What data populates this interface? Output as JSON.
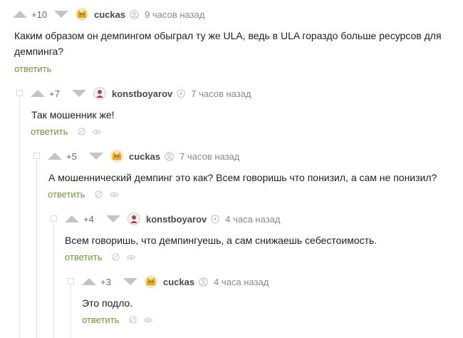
{
  "comments": [
    {
      "rating": "+10",
      "username": "cuckas",
      "time": "9 часов назад",
      "text": "Каким образом он демпингом обыграл ту же ULA, ведь в ULA гораздо больше ресурсов для демпинга?",
      "reply_label": "ответить"
    },
    {
      "rating": "+7",
      "username": "konstboyarov",
      "time": "7 часов назад",
      "text": "Так мошенник же!",
      "reply_label": "ответить"
    },
    {
      "rating": "+5",
      "username": "cuckas",
      "time": "7 часов назад",
      "text": "А мошеннический демпинг это как? Всем говоришь что понизил, а сам не понизил?",
      "reply_label": "ответить"
    },
    {
      "rating": "+4",
      "username": "konstboyarov",
      "time": "4 часа назад",
      "text": "Всем говоришь, что демпингуешь, а сам снижаешь себестоимость.",
      "reply_label": "ответить"
    },
    {
      "rating": "+3",
      "username": "cuckas",
      "time": "4 часа назад",
      "text": "Это подло.",
      "reply_label": "ответить"
    }
  ]
}
